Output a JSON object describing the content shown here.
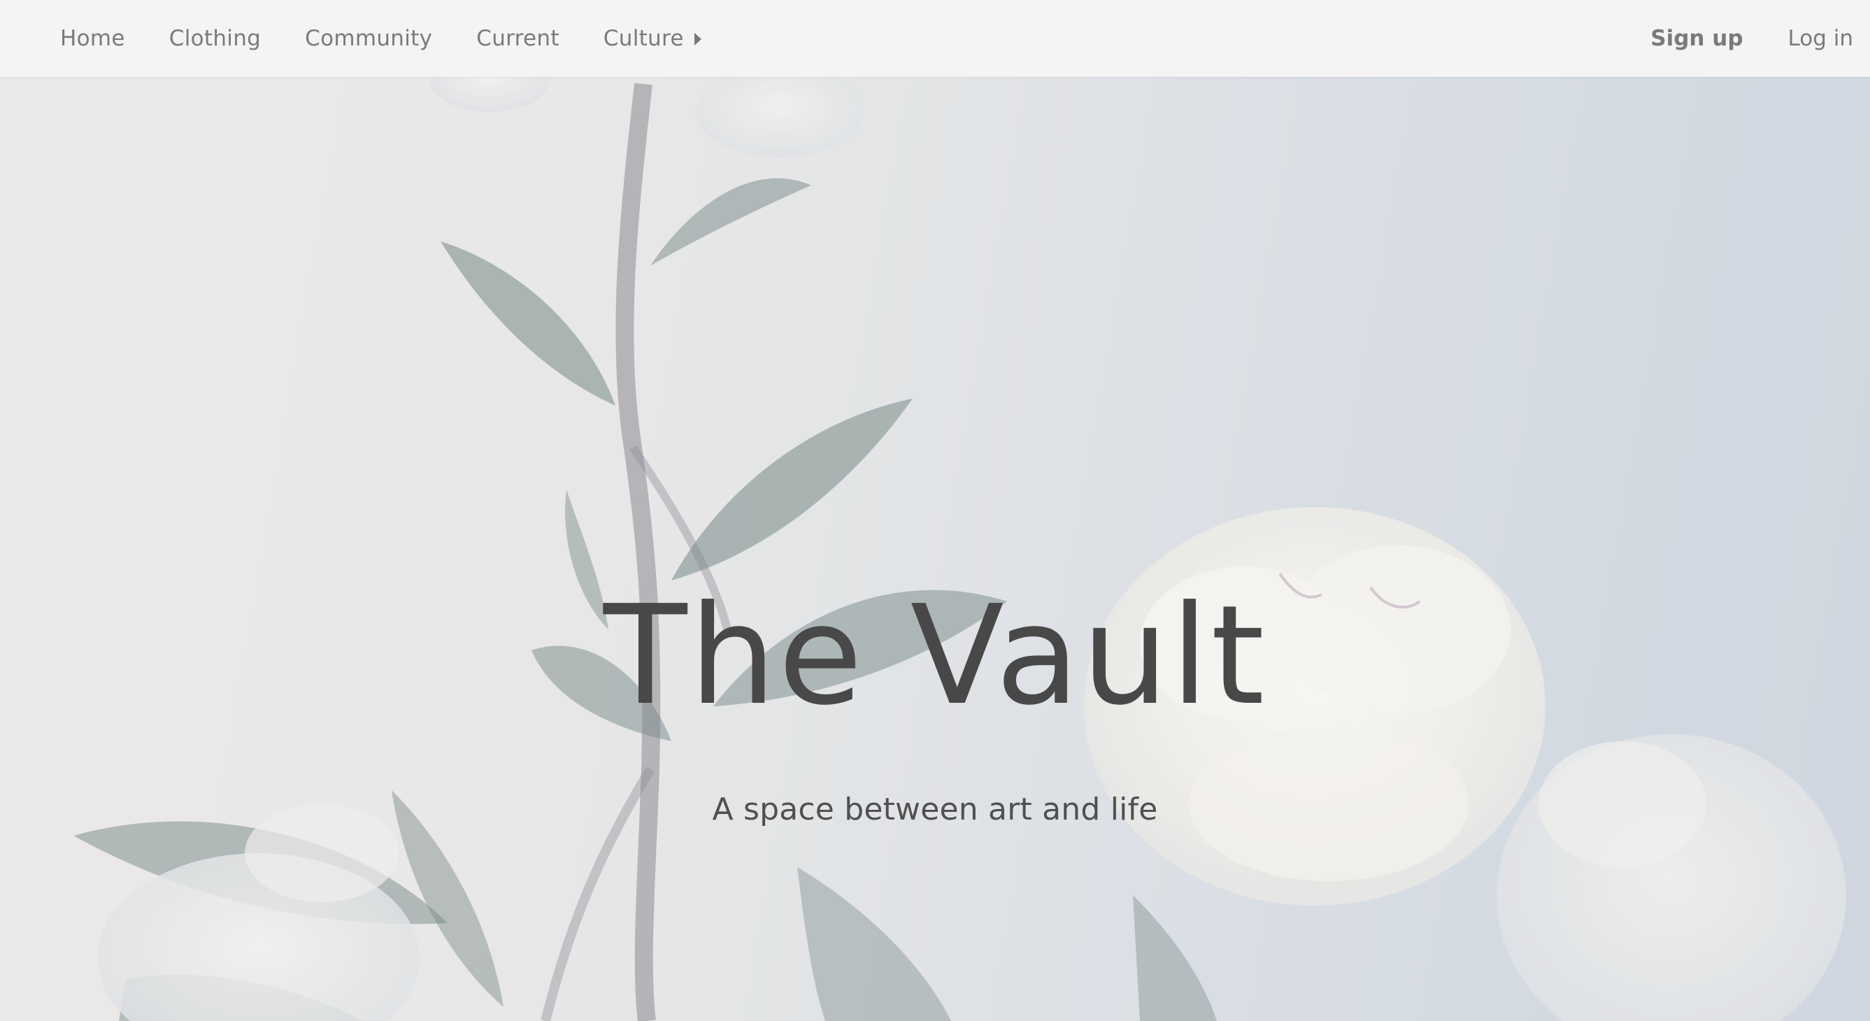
{
  "nav": {
    "items": [
      {
        "label": "Home"
      },
      {
        "label": "Clothing"
      },
      {
        "label": "Community"
      },
      {
        "label": "Current"
      },
      {
        "label": "Culture"
      }
    ],
    "signup_label": "Sign up",
    "login_label": "Log in"
  },
  "hero": {
    "title": "The Vault",
    "subtitle": "A space between art and life"
  },
  "icons": {
    "culture_dropdown": "caret-right-icon"
  },
  "colors": {
    "nav_background": "#f4f4f4",
    "nav_text": "#7a7a7a",
    "title_text": "#484848",
    "leaf": "#5f7471",
    "stem": "#6b6470",
    "petal": "#f7f5f1"
  }
}
